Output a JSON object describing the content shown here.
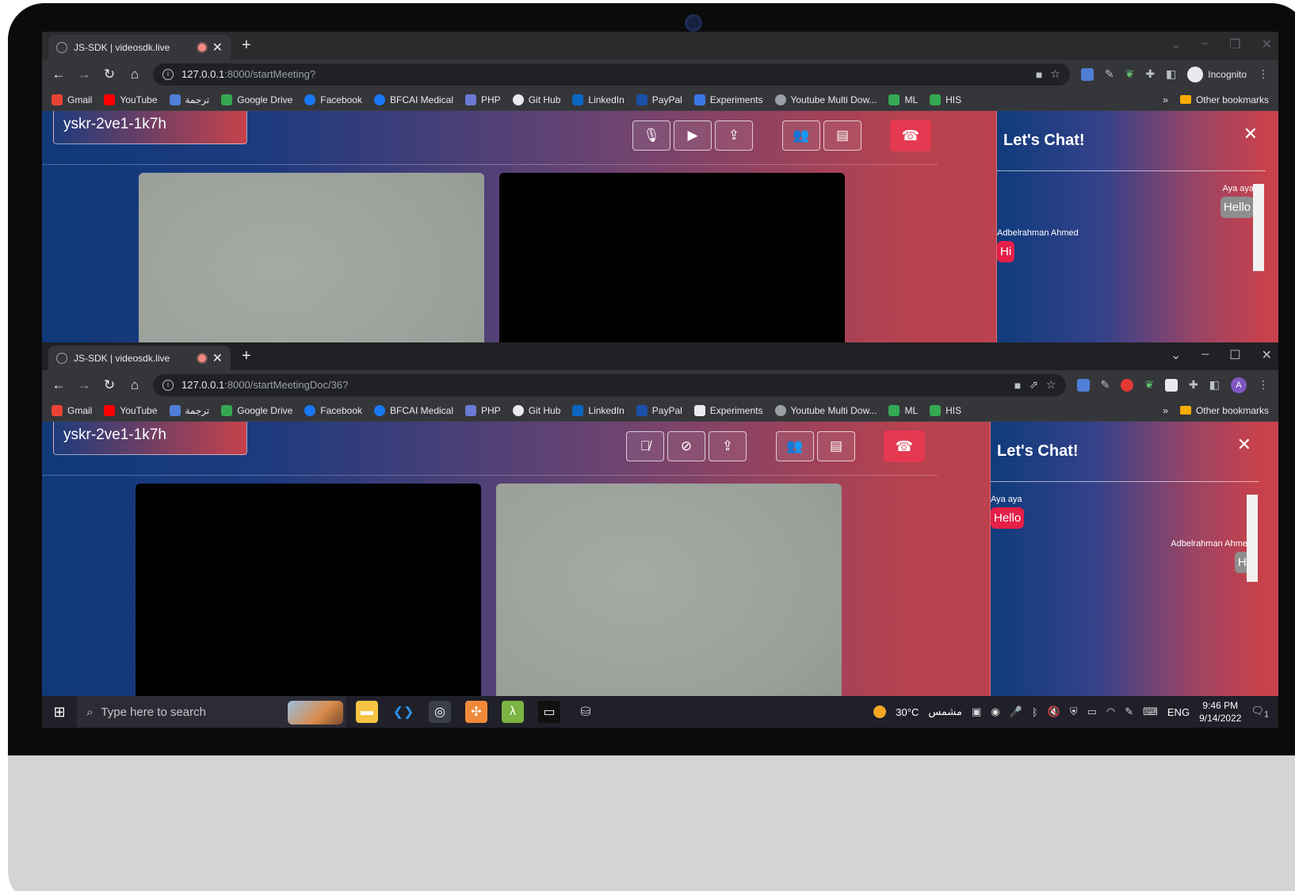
{
  "colors": {
    "accent_red": "#e53951",
    "bubble_red": "#e41f48",
    "bubble_grey": "#8e8e8e",
    "gradient_start": "#10397a",
    "gradient_end": "#c8414b"
  },
  "top_window": {
    "tab_title": "JS-SDK | videosdk.live",
    "url_host": "127.0.0.1",
    "url_rest": ":8000/startMeeting?",
    "profile_label": "Incognito",
    "bookmarks": [
      "Gmail",
      "YouTube",
      "ترجمة",
      "Google Drive",
      "Facebook",
      "BFCAI Medical",
      "PHP",
      "Git Hub",
      "LinkedIn",
      "PayPal",
      "Experiments",
      "Youtube Multi Dow...",
      "ML",
      "HIS"
    ],
    "other_bookmarks": "Other bookmarks",
    "meeting_id": "yskr-2ve1-1k7h",
    "chat_title": "Let's Chat!",
    "messages": [
      {
        "sender": "Aya aya",
        "text": "Hello",
        "side": "right"
      },
      {
        "sender": "Adbelrahman Ahmed",
        "text": "Hi",
        "side": "left"
      }
    ]
  },
  "bottom_window": {
    "tab_title": "JS-SDK | videosdk.live",
    "url_host": "127.0.0.1",
    "url_rest": ":8000/startMeetingDoc/36?",
    "avatar_letter": "A",
    "bookmarks": [
      "Gmail",
      "YouTube",
      "ترجمة",
      "Google Drive",
      "Facebook",
      "BFCAI Medical",
      "PHP",
      "Git Hub",
      "LinkedIn",
      "PayPal",
      "Experiments",
      "Youtube Multi Dow...",
      "ML",
      "HIS"
    ],
    "other_bookmarks": "Other bookmarks",
    "meeting_id": "yskr-2ve1-1k7h",
    "chat_title": "Let's Chat!",
    "messages": [
      {
        "sender": "Aya aya",
        "text": "Hello",
        "side": "left"
      },
      {
        "sender": "Adbelrahman Ahmed",
        "text": "Hi",
        "side": "right"
      }
    ]
  },
  "taskbar": {
    "search_placeholder": "Type here to search",
    "weather": "30°C",
    "weather_desc": "مشمس",
    "language": "ENG",
    "time": "9:46 PM",
    "date": "9/14/2022",
    "notification_count": "1"
  },
  "icons": {
    "back": "arrow-left-icon",
    "forward": "arrow-right-icon",
    "reload": "reload-icon",
    "home": "home-icon",
    "mic": "microphone-icon",
    "mic_off": "microphone-off-icon",
    "camera": "camera-icon",
    "camera_off": "camera-off-icon",
    "screen_share": "screen-share-icon",
    "participants": "participants-icon",
    "chat": "chat-icon",
    "end_call": "phone-hangup-icon"
  }
}
